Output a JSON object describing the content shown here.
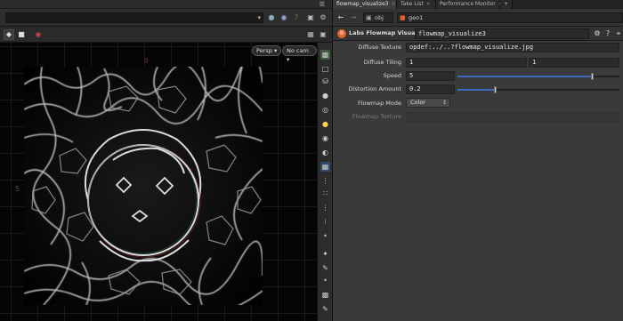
{
  "viewer": {
    "camera_menu": "Persp ▾",
    "cam_menu": "No cam ▾",
    "grid_labels": [
      "0",
      "5"
    ]
  },
  "tabs": [
    {
      "label": "flowmap_visualize3",
      "close": "×",
      "active": true
    },
    {
      "label": "Take List",
      "close": "×",
      "active": false
    },
    {
      "label": "Performance Monitor",
      "close": "×",
      "active": false
    }
  ],
  "add_tab": "+",
  "nav": {
    "back_icon": "←",
    "forward_icon": "→",
    "path_obj": "obj",
    "path_geo": "geo1"
  },
  "node": {
    "type_label": "Labs Flowmap Visualize",
    "name": "flowmap_visualize3",
    "type_icon": "gear-node-icon"
  },
  "params": {
    "diffuse_texture": {
      "label": "Diffuse Texture",
      "value": "opdef:../..?flowmap_visualize.jpg"
    },
    "diffuse_tiling": {
      "label": "Diffuse Tiling",
      "x": "1",
      "y": "1"
    },
    "speed": {
      "label": "Speed",
      "value": "5",
      "slider_fraction": 0.83
    },
    "distortion_amount": {
      "label": "Distortion Amount",
      "value": "0.2",
      "slider_fraction": 0.23
    },
    "flowmap_mode": {
      "label": "Flowmap Mode",
      "value": "Color"
    },
    "flowmap_texture": {
      "label": "Flowmap Texture",
      "value": ""
    }
  },
  "colors": {
    "accent": "#3d6bbf",
    "node_icon": "#e4622a",
    "panel_bg": "#3a3a3a"
  }
}
